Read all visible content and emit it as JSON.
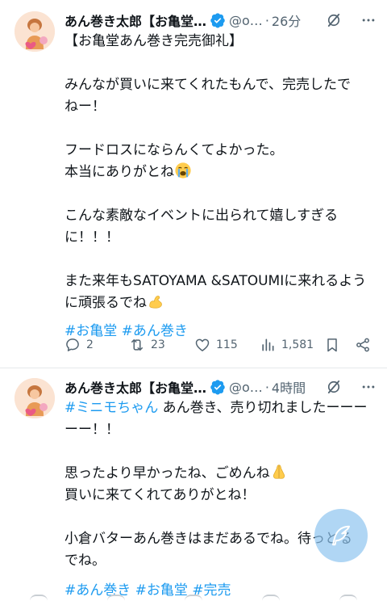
{
  "tweets": [
    {
      "display_name": "あん巻き太郎【お亀堂…",
      "handle": "@o…",
      "separator": "·",
      "time": "26分",
      "lines": [
        "【お亀堂あん巻き完売御礼】",
        "",
        "みんなが買いに来てくれたもんで、完売したで",
        "ねー！",
        "",
        "フードロスにならんくてよかった。",
        "本当にありがとね",
        "",
        "こんな素敵なイベントに出られて嬉しすぎる",
        "に！！！",
        "",
        "また来年もSATOYAMA &SATOUMIに来れるよう",
        "に頑張るでね"
      ],
      "emojis": [
        "loudly-crying-face",
        "flexed-biceps"
      ],
      "hashtags": [
        "#お亀堂",
        "#あん巻き"
      ],
      "replies": "2",
      "reposts": "23",
      "likes": "115",
      "views": "1,581"
    },
    {
      "display_name": "あん巻き太郎【お亀堂…",
      "handle": "@o…",
      "separator": "·",
      "time": "4時間",
      "lead_hashtag": "#ミニモちゃん",
      "lines": [
        " あん巻き、売り切れましたーーー",
        "ーー！！",
        "",
        "思ったより早かったね、ごめんね",
        "買いに来てくれてありがとね！",
        "",
        "小倉バターあん巻きはまだあるでね。待っとる",
        "でね。"
      ],
      "emojis": [
        "folded-hands"
      ],
      "hashtags": [
        "#あん巻き",
        "#お亀堂",
        "#完売"
      ]
    }
  ],
  "colors": {
    "accent": "#1d9bf0",
    "text": "#0f1419",
    "muted": "#536471",
    "divider": "#e6e9ec"
  },
  "icons": [
    "verified-icon",
    "grok-icon",
    "more-icon",
    "reply-icon",
    "repost-icon",
    "like-icon",
    "views-icon",
    "bookmark-icon",
    "share-icon",
    "compose-icon"
  ]
}
